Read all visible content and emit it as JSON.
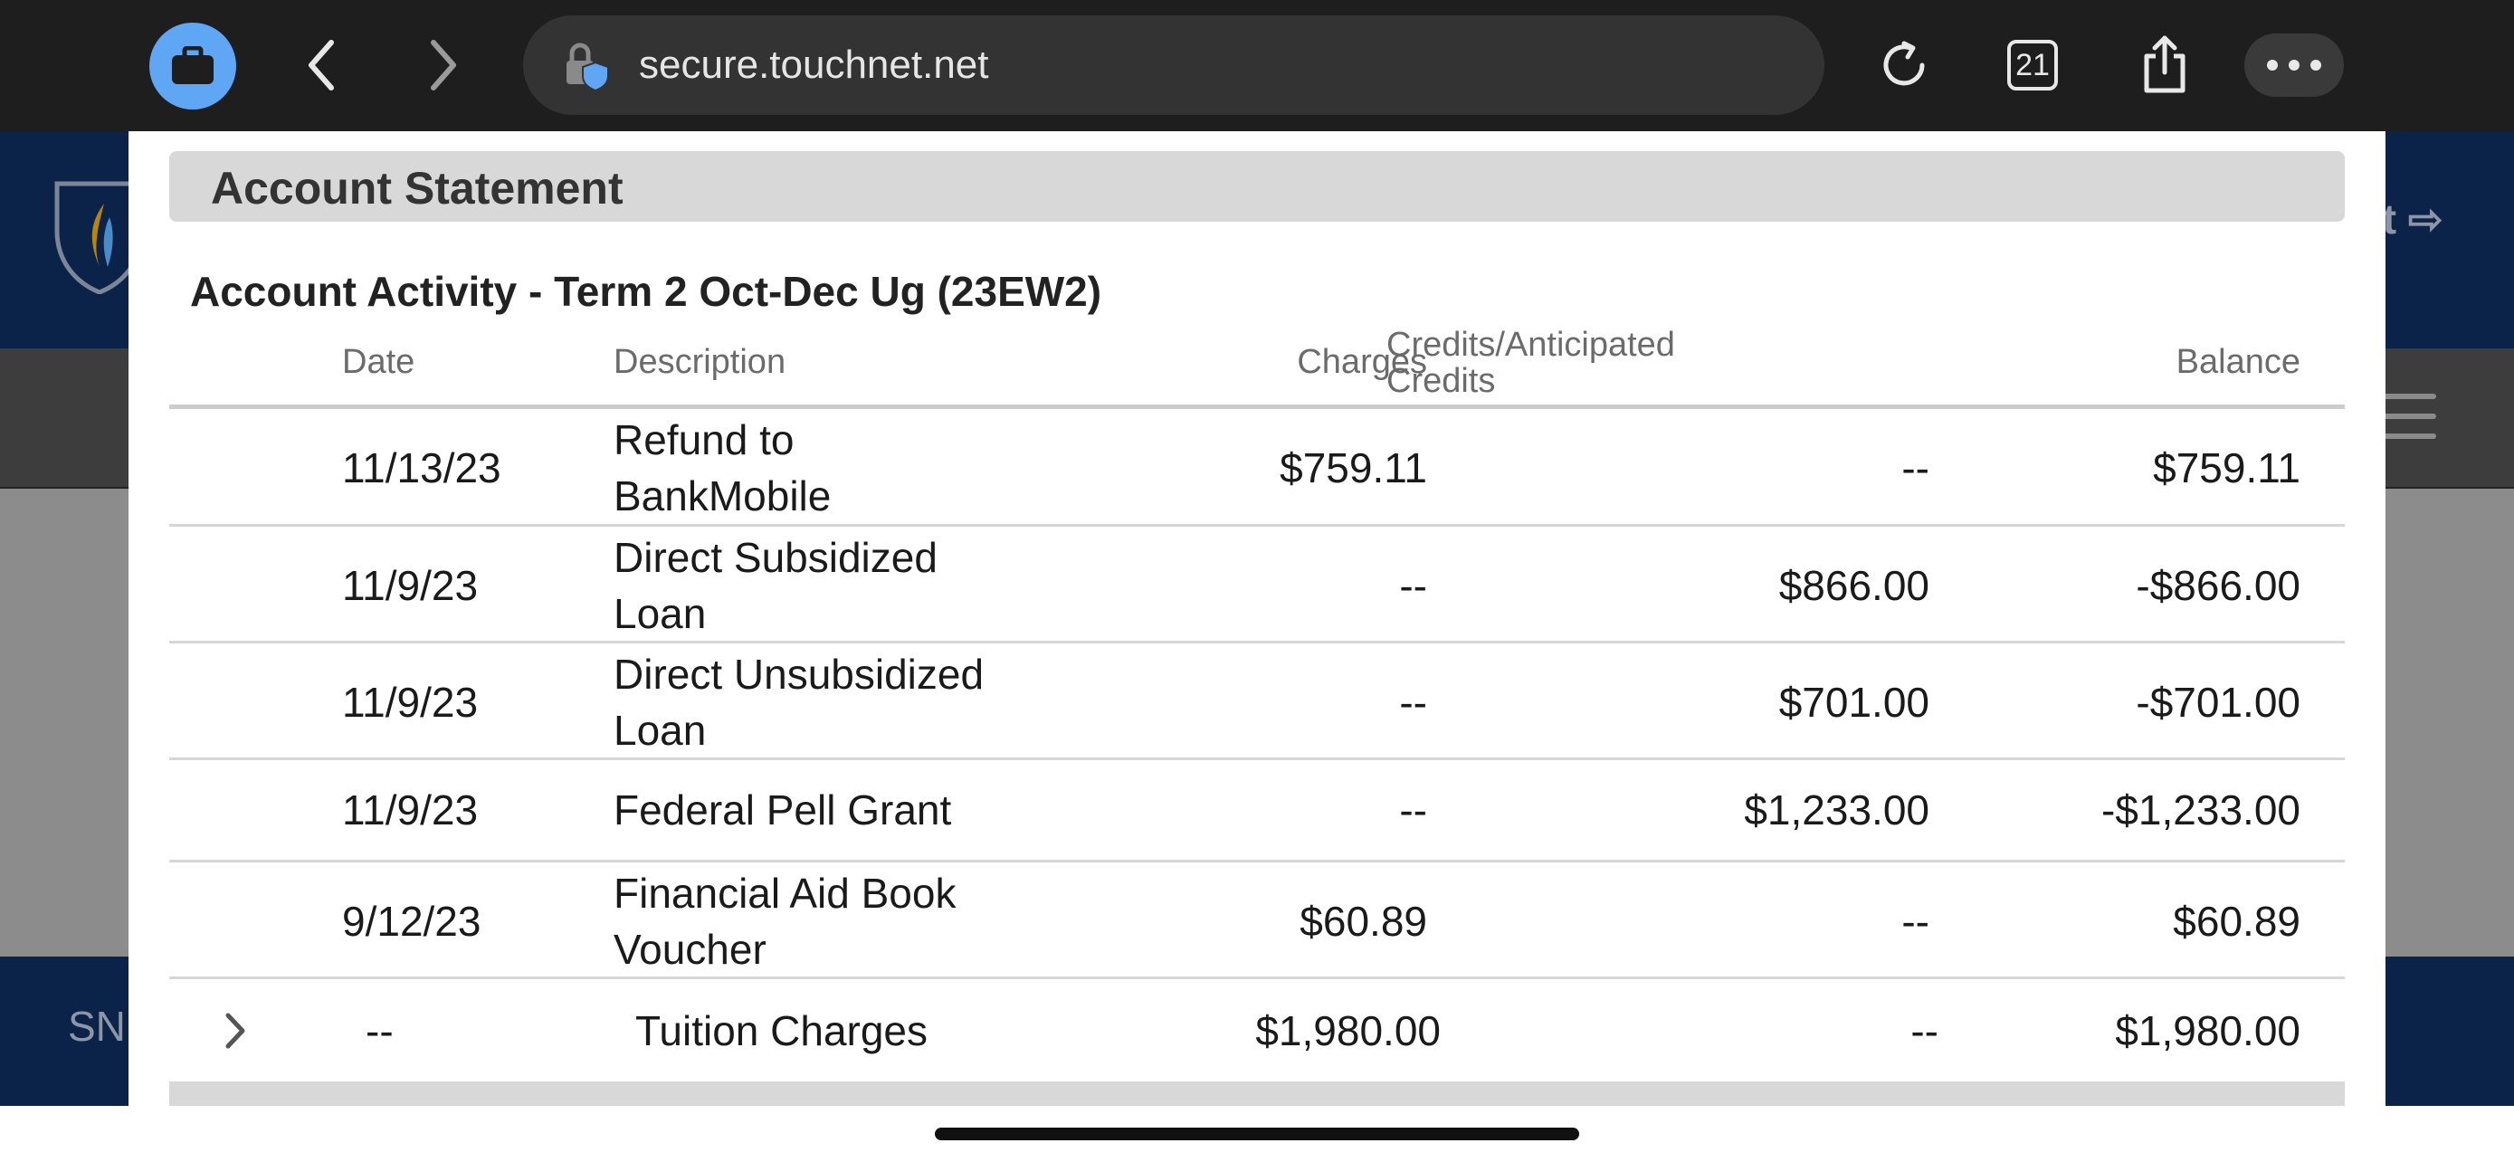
{
  "browser": {
    "url": "secure.touchnet.net",
    "tab_count": "21"
  },
  "background": {
    "header_partial_text": "it",
    "footer_partial_text": "SN"
  },
  "statement": {
    "title": "Account Statement",
    "activity_title": "Account Activity - Term 2 Oct-Dec Ug (23EW2)",
    "columns": {
      "date": "Date",
      "description": "Description",
      "charges": "Charges",
      "credits_line1": "Credits/Anticipated",
      "credits_line2": "Credits",
      "balance": "Balance"
    },
    "rows": [
      {
        "date": "11/13/23",
        "desc_line1": "Refund to",
        "desc_line2": "BankMobile",
        "charges": "$759.11",
        "credits": "--",
        "balance": "$759.11"
      },
      {
        "date": "11/9/23",
        "desc_line1": "Direct Subsidized",
        "desc_line2": "Loan",
        "charges": "--",
        "credits": "$866.00",
        "balance": "-$866.00"
      },
      {
        "date": "11/9/23",
        "desc_line1": "Direct Unsubsidized",
        "desc_line2": "Loan",
        "charges": "--",
        "credits": "$701.00",
        "balance": "-$701.00"
      },
      {
        "date": "11/9/23",
        "desc_line1": "Federal Pell Grant",
        "desc_line2": "",
        "charges": "--",
        "credits": "$1,233.00",
        "balance": "-$1,233.00"
      },
      {
        "date": "9/12/23",
        "desc_line1": "Financial Aid Book",
        "desc_line2": "Voucher",
        "charges": "$60.89",
        "credits": "--",
        "balance": "$60.89"
      }
    ],
    "group_row": {
      "date": "--",
      "description": "Tuition Charges",
      "charges": "$1,980.00",
      "credits": "--",
      "balance": "$1,980.00"
    }
  }
}
